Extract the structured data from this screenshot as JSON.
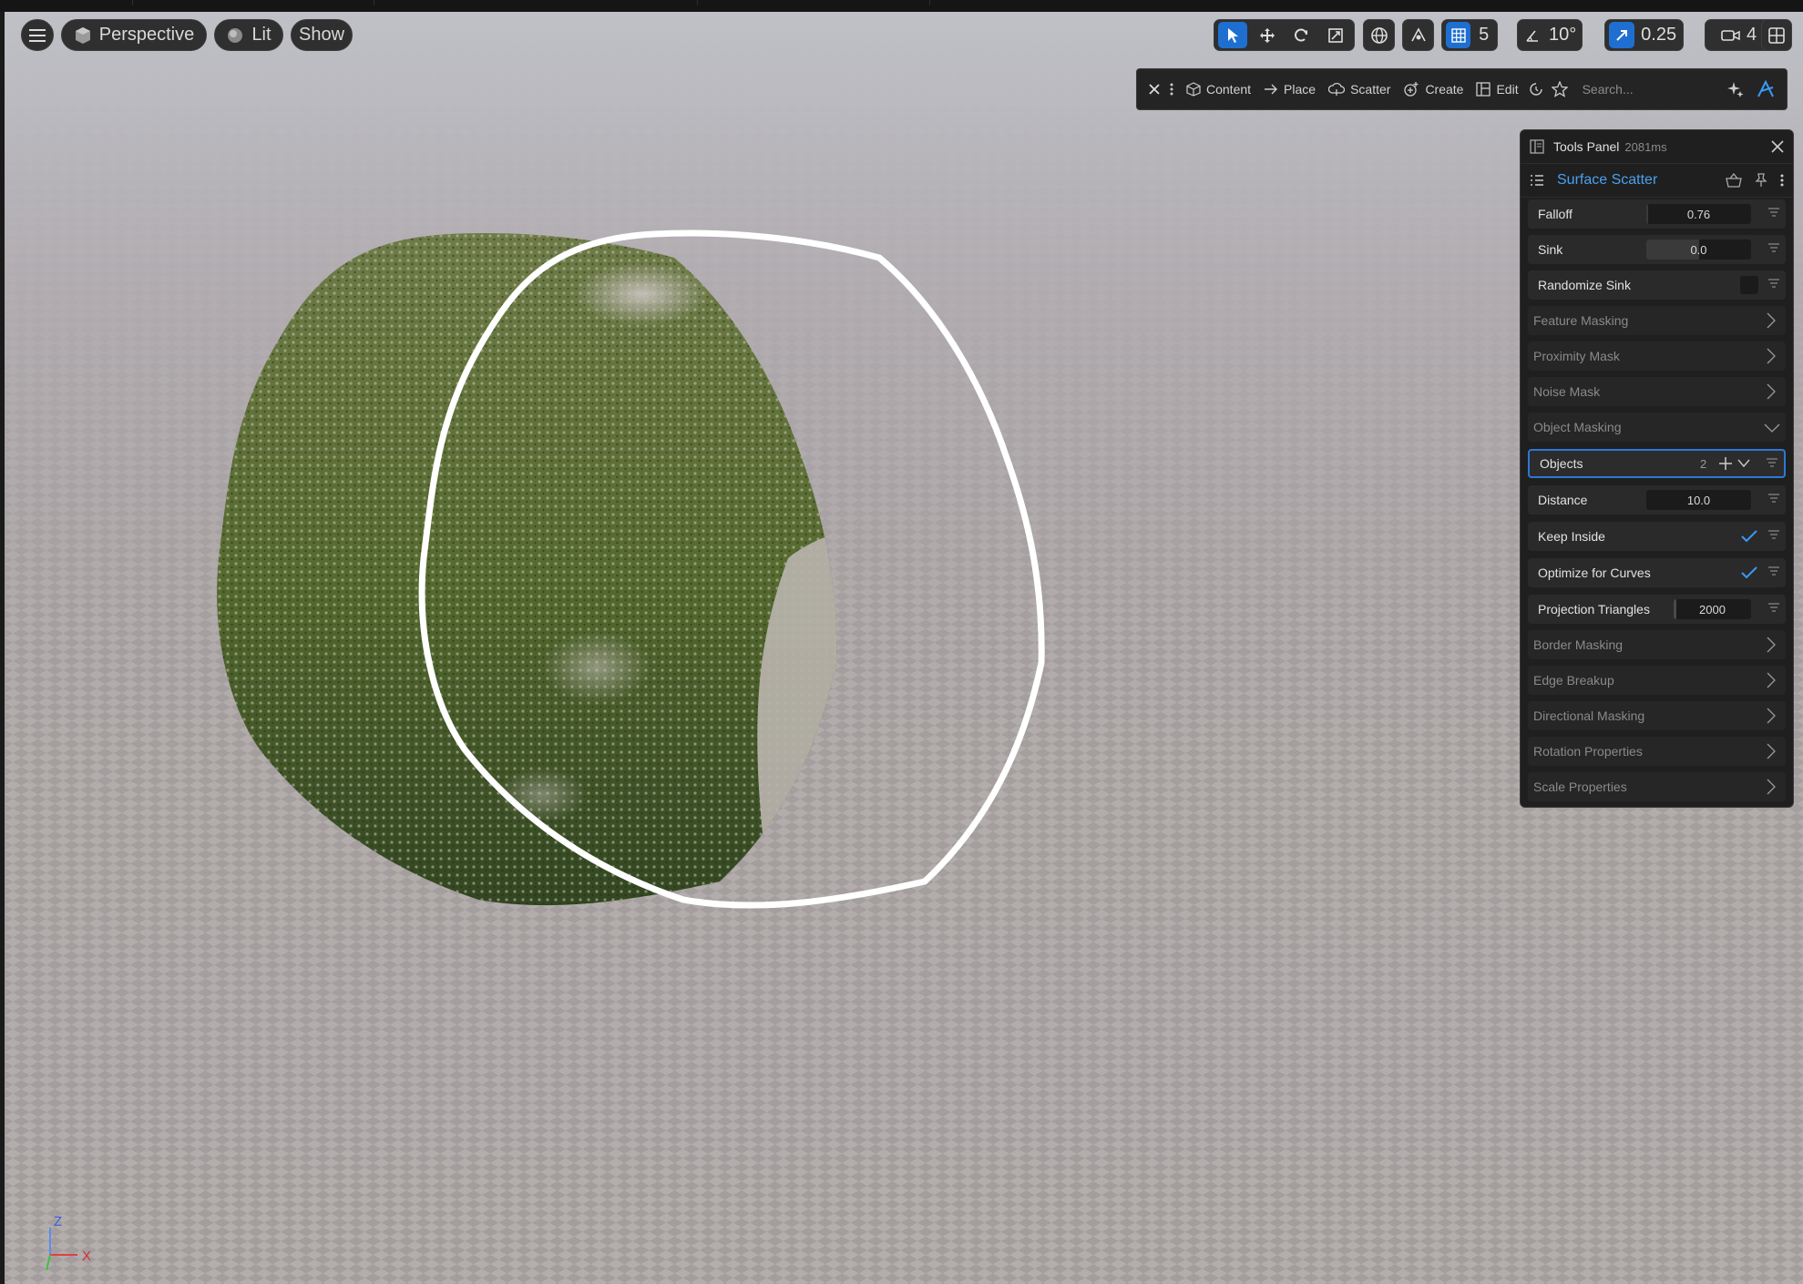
{
  "viewport_toolbar": {
    "menu_icon": "hamburger-icon",
    "perspective_label": "Perspective",
    "lit_label": "Lit",
    "show_label": "Show",
    "grid_snap_value": "5",
    "angle_snap_value": "10°",
    "scale_snap_value": "0.25",
    "camera_speed_value": "4"
  },
  "mode_toolbar": {
    "items": [
      {
        "label": "Content",
        "icon": "cube-icon"
      },
      {
        "label": "Place",
        "icon": "arrow-right-icon"
      },
      {
        "label": "Scatter",
        "icon": "scatter-icon"
      },
      {
        "label": "Create",
        "icon": "create-icon"
      },
      {
        "label": "Edit",
        "icon": "edit-icon"
      }
    ],
    "search_placeholder": "Search..."
  },
  "tools_panel": {
    "title": "Tools Panel",
    "time": "2081ms",
    "tool_name": "Surface Scatter",
    "rows": {
      "falloff": {
        "label": "Falloff",
        "value": "0.76",
        "fill": 0.02
      },
      "sink": {
        "label": "Sink",
        "value": "0.0",
        "fill": 0.5
      },
      "randomize_sink": {
        "label": "Randomize Sink",
        "checked": false
      },
      "feature_masking": {
        "label": "Feature Masking"
      },
      "proximity_mask": {
        "label": "Proximity Mask"
      },
      "noise_mask": {
        "label": "Noise Mask"
      },
      "object_masking": {
        "label": "Object Masking"
      },
      "objects": {
        "label": "Objects",
        "count": "2"
      },
      "distance": {
        "label": "Distance",
        "value": "10.0"
      },
      "keep_inside": {
        "label": "Keep Inside",
        "checked": true
      },
      "optimize_curves": {
        "label": "Optimize for Curves",
        "checked": true
      },
      "projection_triangles": {
        "label": "Projection Triangles",
        "value": "2000",
        "fill": 0.03
      },
      "border_masking": {
        "label": "Border Masking"
      },
      "edge_breakup": {
        "label": "Edge Breakup"
      },
      "directional_masking": {
        "label": "Directional Masking"
      },
      "rotation_properties": {
        "label": "Rotation Properties"
      },
      "scale_properties": {
        "label": "Scale Properties"
      }
    }
  },
  "axis_gizmo": {
    "z": "Z",
    "x": "X"
  },
  "colors": {
    "accent": "#1f6fd1",
    "link": "#4aa0f0",
    "panel": "#1f1f1f"
  }
}
